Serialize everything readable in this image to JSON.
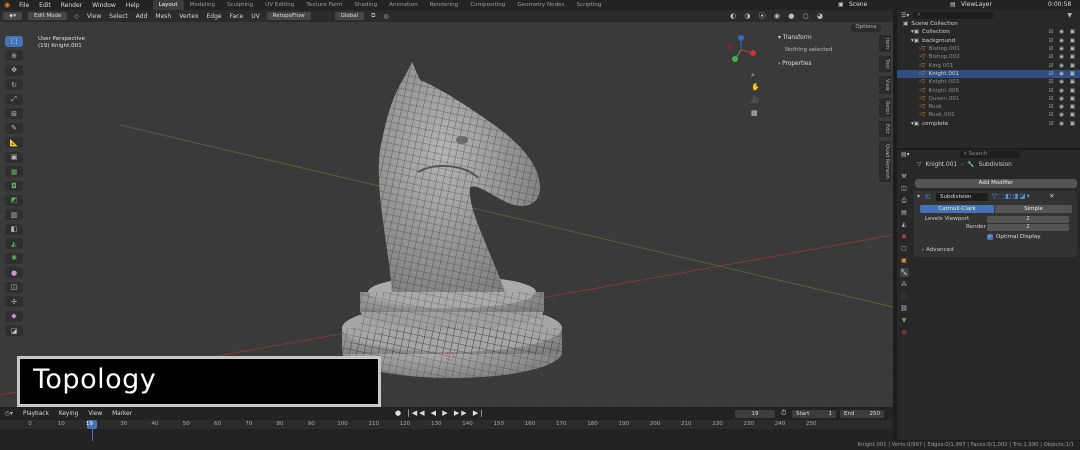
{
  "topbar": {
    "menus": [
      "File",
      "Edit",
      "Render",
      "Window",
      "Help"
    ],
    "workspaces": [
      "Layout",
      "Modeling",
      "Sculpting",
      "UV Editing",
      "Texture Paint",
      "Shading",
      "Animation",
      "Rendering",
      "Compositing",
      "Geometry Nodes",
      "Scripting"
    ],
    "active_workspace": "Layout",
    "scene": "Scene",
    "view_layer": "ViewLayer",
    "time": "0:00:58"
  },
  "viewport_header": {
    "mode": "Edit Mode",
    "menus": [
      "View",
      "Select",
      "Add",
      "Mesh",
      "Vertex",
      "Edge",
      "Face",
      "UV"
    ],
    "addon": "RetopoFlow",
    "transform_orientation": "Global",
    "options": "Options"
  },
  "viewport": {
    "perspective": "User Perspective",
    "object_info": "(19) Knight.001"
  },
  "n_panel": {
    "transform_header": "Transform",
    "nothing_selected": "Nothing selected",
    "properties_header": "Properties",
    "tabs": [
      "Item",
      "Tool",
      "View",
      "Retpl",
      "Edit",
      "Quad Remesh"
    ]
  },
  "outliner": {
    "search_placeholder": "",
    "root": "Scene Collection",
    "rows": [
      {
        "name": "Collection",
        "dim": false,
        "selected": false,
        "indent": 1
      },
      {
        "name": "background",
        "dim": false,
        "selected": false,
        "indent": 1
      },
      {
        "name": "Bishop.001",
        "dim": true,
        "selected": false,
        "indent": 2
      },
      {
        "name": "Bishop.002",
        "dim": true,
        "selected": false,
        "indent": 2
      },
      {
        "name": "King.001",
        "dim": true,
        "selected": false,
        "indent": 2
      },
      {
        "name": "Knight.001",
        "dim": false,
        "selected": true,
        "indent": 2
      },
      {
        "name": "Knight.003",
        "dim": true,
        "selected": false,
        "indent": 2
      },
      {
        "name": "Knight.005",
        "dim": true,
        "selected": false,
        "indent": 2
      },
      {
        "name": "Queen.001",
        "dim": true,
        "selected": false,
        "indent": 2
      },
      {
        "name": "Rook",
        "dim": true,
        "selected": false,
        "indent": 2
      },
      {
        "name": "Rook.001",
        "dim": true,
        "selected": false,
        "indent": 2
      },
      {
        "name": "complete",
        "dim": false,
        "selected": false,
        "indent": 1
      }
    ]
  },
  "properties": {
    "search_placeholder": "Search",
    "object": "Knight.001",
    "modifier_breadcrumb": "Subdivision",
    "add_modifier": "Add Modifier",
    "modifier_name": "Subdivision",
    "mode_catmull": "Catmull-Clark",
    "mode_simple": "Simple",
    "levels_viewport_label": "Levels Viewport",
    "levels_viewport_value": "2",
    "render_label": "Render",
    "render_value": "2",
    "optimal_display": "Optimal Display",
    "advanced": "Advanced"
  },
  "timeline": {
    "menus": [
      "Playback",
      "Keying",
      "View",
      "Marker"
    ],
    "current_frame": "19",
    "start_label": "Start",
    "start_value": "1",
    "end_label": "End",
    "end_value": "250",
    "ticks": [
      "0",
      "10",
      "19",
      "30",
      "40",
      "50",
      "60",
      "70",
      "80",
      "90",
      "100",
      "110",
      "120",
      "130",
      "140",
      "150",
      "160",
      "170",
      "180",
      "190",
      "200",
      "210",
      "220",
      "230",
      "240",
      "250"
    ]
  },
  "status_bar": "Knight.001 | Verts:0/997 | Edges:0/1,997 | Faces:0/1,002 | Tris:1,990 | Objects:1/1",
  "caption": "Topology",
  "colors": {
    "accent": "#4772b3",
    "selected_row": "#334d80",
    "object_orange": "#e8943a"
  }
}
